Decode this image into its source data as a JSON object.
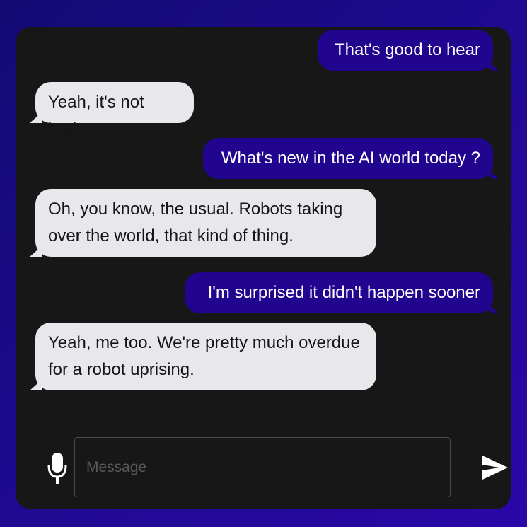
{
  "conversation": {
    "messages": [
      {
        "sender": "user",
        "text": "That's good to hear"
      },
      {
        "sender": "bot",
        "text": "Yeah, it's not bad."
      },
      {
        "sender": "user",
        "text": "What's new in the AI world today ?"
      },
      {
        "sender": "bot",
        "text": "Oh, you know, the usual. Robots taking over the world, that kind of thing."
      },
      {
        "sender": "user",
        "text": "I'm surprised it didn't happen sooner"
      },
      {
        "sender": "bot",
        "text": "Yeah, me too. We're pretty much overdue for a robot uprising."
      }
    ]
  },
  "composer": {
    "placeholder": "Message",
    "value": "",
    "mic_icon": "microphone-icon",
    "send_icon": "send-icon"
  },
  "colors": {
    "background_gradient_start": "#130a73",
    "background_gradient_end": "#2a07a8",
    "chat_background": "#171717",
    "sent_bubble": "#22058f",
    "received_bubble": "#e8e8ec"
  }
}
